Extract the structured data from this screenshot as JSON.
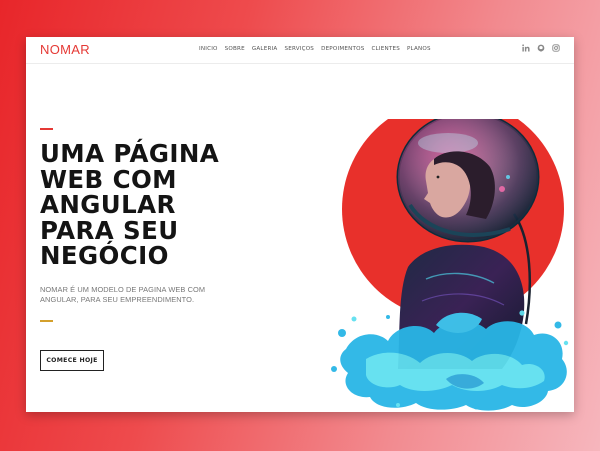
{
  "brand": {
    "name": "NOMAR",
    "accent_color": "#e53935"
  },
  "nav": {
    "items": [
      "INICIO",
      "SOBRE",
      "GALERIA",
      "SERVIÇOS",
      "DEPOIMENTOS",
      "CLIENTES",
      "PLANOS"
    ]
  },
  "social": {
    "icons": [
      "linkedin-icon",
      "github-icon",
      "instagram-icon"
    ]
  },
  "hero": {
    "headline_lines": [
      "UMA PÁGINA",
      "WEB COM",
      "ANGULAR",
      "PARA SEU",
      "NEGÓCIO"
    ],
    "subtext_lines": [
      "NOMAR É UM MODELO DE PAGINA WEB COM",
      "ANGULAR, PARA SEU EMPREENDIMENTO."
    ],
    "cta_label": "COMECE HOJE",
    "accent_bar_colors": {
      "top": "#e53935",
      "bottom": "#d4a02c"
    },
    "illustration": "astronaut-helmet-portrait-with-red-sun-and-cyan-paint-splash"
  }
}
